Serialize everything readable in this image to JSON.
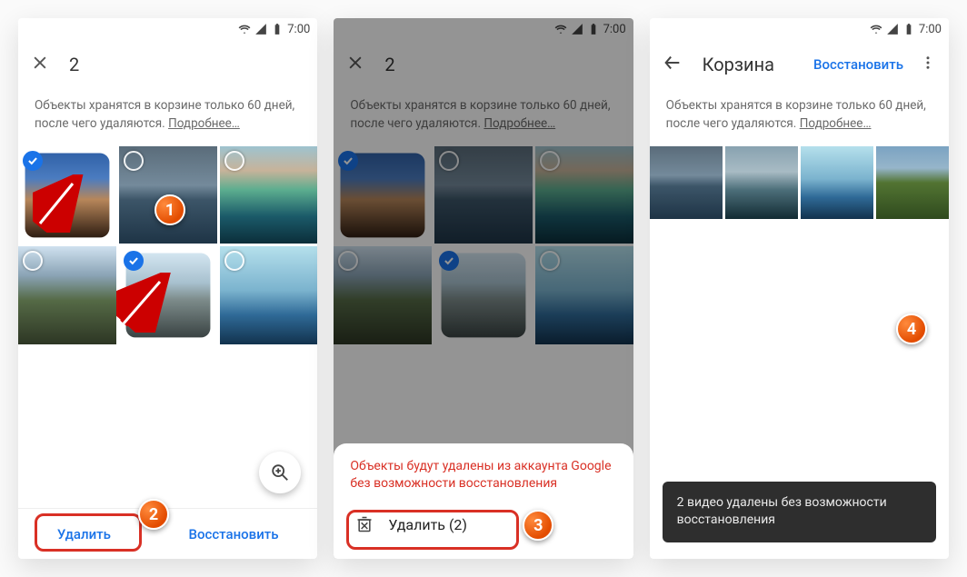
{
  "status": {
    "time": "7:00"
  },
  "panel1": {
    "selection_count": "2",
    "notice_text": "Объекты хранятся в корзине только 60 дней, после чего удаляются.",
    "more_label": "Подробнее…",
    "delete_label": "Удалить",
    "restore_label": "Восстановить"
  },
  "panel2": {
    "selection_count": "2",
    "notice_text": "Объекты хранятся в корзине только 60 дней, после чего удаляются.",
    "more_label": "Подробнее…",
    "warning": "Объекты будут удалены из аккаунта Google без возможности восстановления",
    "delete_action": "Удалить (2)"
  },
  "panel3": {
    "title": "Корзина",
    "restore_label": "Восстановить",
    "notice_text": "Объекты хранятся в корзине только 60 дней, после чего удаляются.",
    "more_label": "Подробнее…",
    "toast": "2 видео удалены без возможности восстановления"
  },
  "badges": {
    "b1": "1",
    "b2": "2",
    "b3": "3",
    "b4": "4"
  }
}
